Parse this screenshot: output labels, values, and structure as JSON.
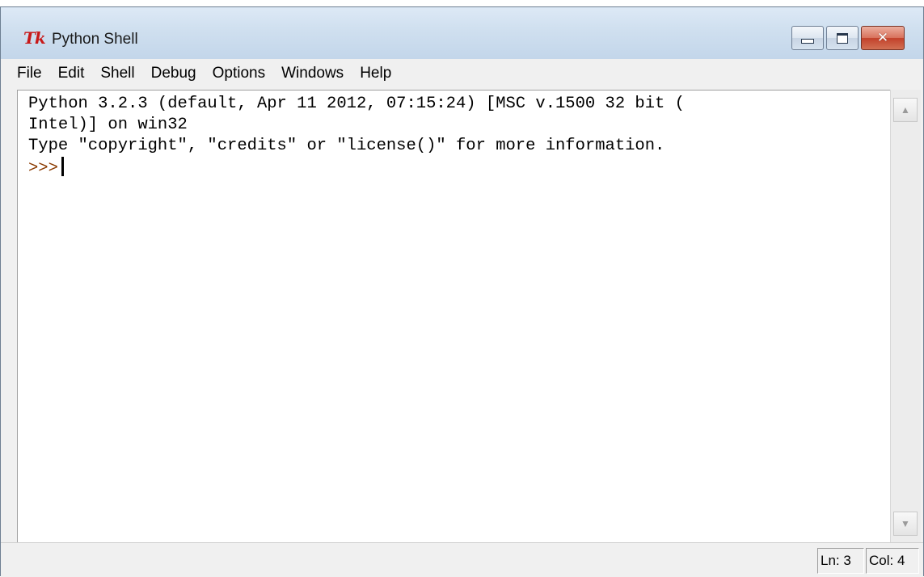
{
  "window": {
    "title": "Python Shell",
    "app_icon": "Tk",
    "buttons": {
      "minimize_icon": "minimize-icon",
      "maximize_icon": "maximize-icon",
      "close_icon": "close-icon",
      "close_glyph": "✕"
    }
  },
  "menu": {
    "items": [
      {
        "label": "File"
      },
      {
        "label": "Edit"
      },
      {
        "label": "Shell"
      },
      {
        "label": "Debug"
      },
      {
        "label": "Options"
      },
      {
        "label": "Windows"
      },
      {
        "label": "Help"
      }
    ]
  },
  "shell": {
    "lines": [
      "Python 3.2.3 (default, Apr 11 2012, 07:15:24) [MSC v.1500 32 bit (",
      "Intel)] on win32",
      "Type \"copyright\", \"credits\" or \"license()\" for more information."
    ],
    "prompt": ">>>",
    "prompt_color": "#8a3a00"
  },
  "scrollbar": {
    "up_arrow": "▲",
    "down_arrow": "▼"
  },
  "status": {
    "line": "Ln: 3",
    "column": "Col: 4"
  }
}
